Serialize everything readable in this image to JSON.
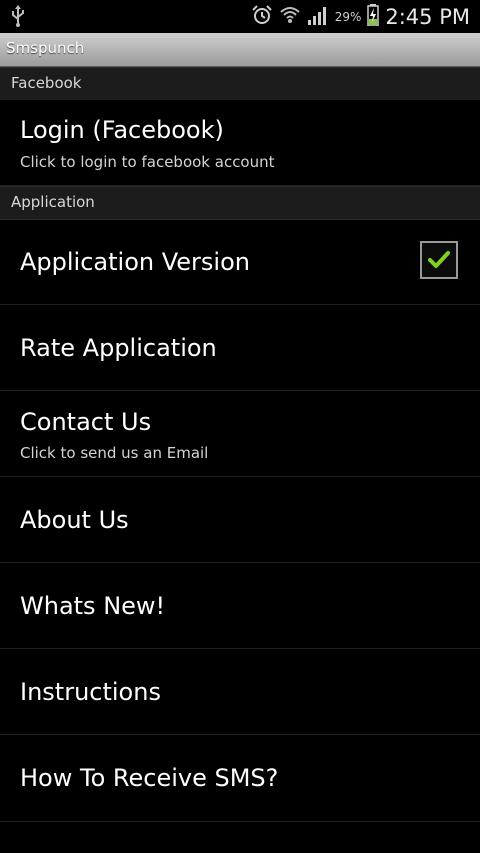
{
  "status_bar": {
    "battery_percent": "29%",
    "time": "2:45 PM"
  },
  "app": {
    "title": "Smspunch"
  },
  "sections": {
    "facebook": {
      "header": "Facebook",
      "login": {
        "title": "Login (Facebook)",
        "summary": "Click to login to facebook account"
      }
    },
    "application": {
      "header": "Application",
      "version": {
        "title": "Application Version",
        "checked": true
      },
      "rate": {
        "title": "Rate Application"
      },
      "contact": {
        "title": "Contact Us",
        "summary": "Click to send us an Email"
      },
      "about": {
        "title": "About Us"
      },
      "whats_new": {
        "title": "Whats New!"
      },
      "instructions": {
        "title": "Instructions"
      },
      "receive_sms": {
        "title": "How To Receive SMS?"
      }
    }
  },
  "colors": {
    "check_accent": "#7ed321",
    "header_bg": "#1c1c1c"
  }
}
